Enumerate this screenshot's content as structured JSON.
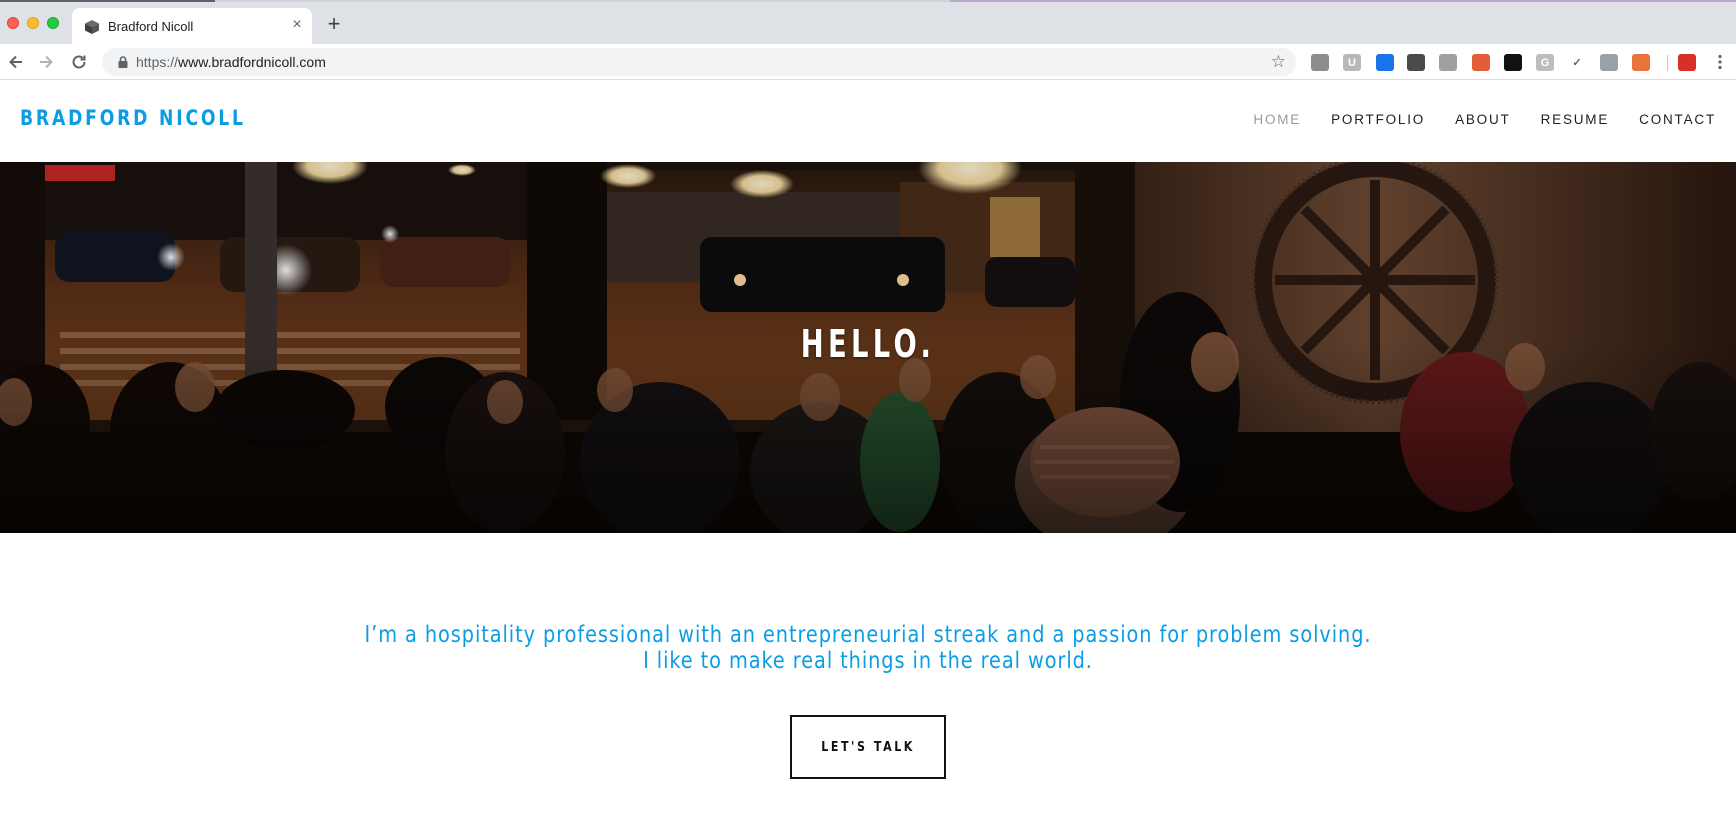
{
  "browser": {
    "tab_title": "Bradford Nicoll",
    "new_tab_symbol": "+",
    "close_symbol": "×",
    "url_scheme": "https://",
    "url_host": "www.bradfordnicoll.com",
    "extensions": [
      {
        "name": "camera-extension-icon",
        "color": "#8c8c8c",
        "glyph": ""
      },
      {
        "name": "ublock-extension-icon",
        "color": "#b7b7b7",
        "glyph": "U"
      },
      {
        "name": "blue-extension-icon",
        "color": "#1a73e8",
        "glyph": ""
      },
      {
        "name": "kaspersky-extension-icon",
        "color": "#4a4a4a",
        "glyph": ""
      },
      {
        "name": "circle-extension-icon",
        "color": "#a0a0a0",
        "glyph": ""
      },
      {
        "name": "rainbow-extension-icon",
        "color": "#e35d3a",
        "glyph": ""
      },
      {
        "name": "pen-extension-icon",
        "color": "#111111",
        "glyph": ""
      },
      {
        "name": "grammarly-extension-icon",
        "color": "#bdbdbd",
        "glyph": "G"
      },
      {
        "name": "check-extension-icon",
        "color": "#ffffff",
        "glyph": "✓"
      },
      {
        "name": "code-extension-icon",
        "color": "#9aa0a6",
        "glyph": ""
      },
      {
        "name": "tomato-extension-icon",
        "color": "#e8743b",
        "glyph": ""
      },
      {
        "name": "fox-extension-icon",
        "color": "#d93025",
        "glyph": ""
      }
    ]
  },
  "site": {
    "title": "BRADFORD NICOLL",
    "nav": [
      {
        "label": "HOME",
        "active": true
      },
      {
        "label": "PORTFOLIO",
        "active": false
      },
      {
        "label": "ABOUT",
        "active": false
      },
      {
        "label": "RESUME",
        "active": false
      },
      {
        "label": "CONTACT",
        "active": false
      }
    ],
    "hero_title": "HELLO.",
    "intro_line1": "I’m a hospitality professional with an entrepreneurial streak and a passion for problem solving.",
    "intro_line2": "I like to make real things in the real world.",
    "cta_label": "LET'S TALK"
  },
  "colors": {
    "brand": "#0a9de6",
    "nav_active": "#9a9a9a",
    "nav_text": "#222222"
  }
}
